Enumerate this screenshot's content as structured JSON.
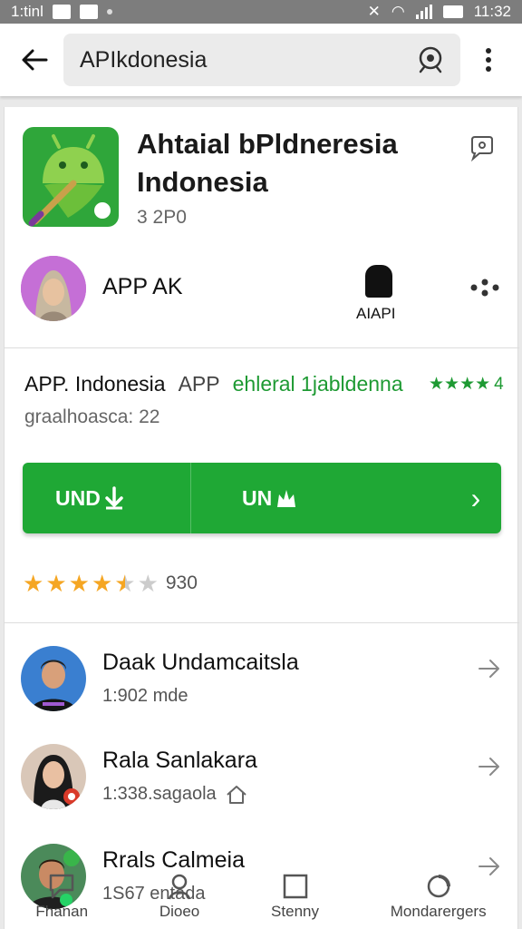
{
  "status_bar": {
    "left_text": "1:tinl",
    "time": "11:32"
  },
  "toolbar": {
    "search_text": "APIkdonesia"
  },
  "app": {
    "title": "Ahtaial bPldneresia Indonesia",
    "subtitle": "3 2P0",
    "icon": "android-icon",
    "brand_color": "#2fa63a"
  },
  "developer": {
    "name": "APP AK",
    "app_label": "AIAPI"
  },
  "info": {
    "name": "APP. Indonesia",
    "type": "APP",
    "link": "ehleral 1jabldenna",
    "stars": "★★★★",
    "rating": "4",
    "meta": "graalhoasca: 22"
  },
  "install": {
    "left_label": "UND",
    "mid_label": "UN",
    "arrow": "›",
    "color": "#1fa835"
  },
  "rating": {
    "count": "930",
    "value": 4.5
  },
  "reviews": [
    {
      "name": "Daak Undamcaitsla",
      "meta": "1:902 mde",
      "has_home": false
    },
    {
      "name": "Rala Sanlakara",
      "meta": "1:338.sagaola",
      "has_home": true
    },
    {
      "name": "Rrals Calmeia",
      "meta": "1S67 entada",
      "has_home": false
    }
  ],
  "bottom_nav": [
    {
      "label": "Fhanan",
      "icon": "chat-icon"
    },
    {
      "label": "Dioeo",
      "icon": "person-icon"
    },
    {
      "label": "Stenny",
      "icon": "square-icon"
    },
    {
      "label": "Mondarergers",
      "icon": "circle-icon"
    }
  ]
}
